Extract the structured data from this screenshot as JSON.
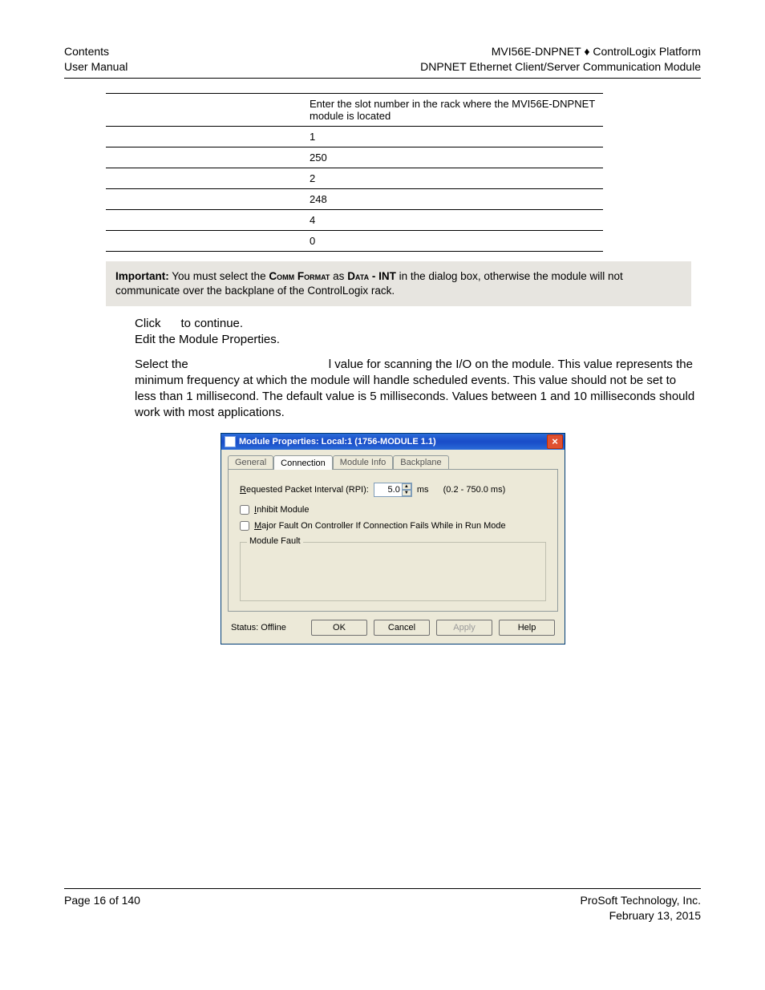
{
  "header": {
    "left1": "Contents",
    "left2": "User Manual",
    "right1": "MVI56E-DNPNET ♦ ControlLogix Platform",
    "right2": "DNPNET Ethernet Client/Server Communication Module"
  },
  "table": {
    "row0": "Enter the slot number in the rack where the MVI56E-DNPNET module is located",
    "row1": "1",
    "row2": "250",
    "row3": "2",
    "row4": "248",
    "row5": "4",
    "row6": "0"
  },
  "important": {
    "label": "Important:",
    "text_before": " You must select the ",
    "comm_format": "Comm Format",
    "mid": " as ",
    "data_int": "Data - INT",
    "text_after": " in the dialog box, otherwise the module will not communicate over the backplane of the ControlLogix rack."
  },
  "body": {
    "click": "Click ",
    "to_continue": " to continue.",
    "edit_line": "Edit the Module Properties.",
    "select_a": "Select the ",
    "select_b": "l value for scanning the I/O on the module. This value represents the minimum frequency at which the module will handle scheduled events. This value should not be set to less than 1 millisecond. The default value is 5 milliseconds. Values between 1 and 10 milliseconds should work with most applications."
  },
  "dialog": {
    "title": "Module Properties: Local:1 (1756-MODULE 1.1)",
    "tabs": {
      "general": "General",
      "connection": "Connection",
      "module_info": "Module Info",
      "backplane": "Backplane"
    },
    "rpi_label": "Requested Packet Interval (RPI):",
    "rpi_value": "5.0",
    "rpi_unit": "ms",
    "rpi_range": "(0.2 - 750.0 ms)",
    "inhibit": "Inhibit Module",
    "major_fault": "Major Fault On Controller If Connection Fails While in Run Mode",
    "module_fault_label": "Module Fault",
    "status": "Status: Offline",
    "buttons": {
      "ok": "OK",
      "cancel": "Cancel",
      "apply": "Apply",
      "help": "Help"
    }
  },
  "footer": {
    "page": "Page 16 of 140",
    "company": "ProSoft Technology, Inc.",
    "date": "February 13, 2015"
  }
}
